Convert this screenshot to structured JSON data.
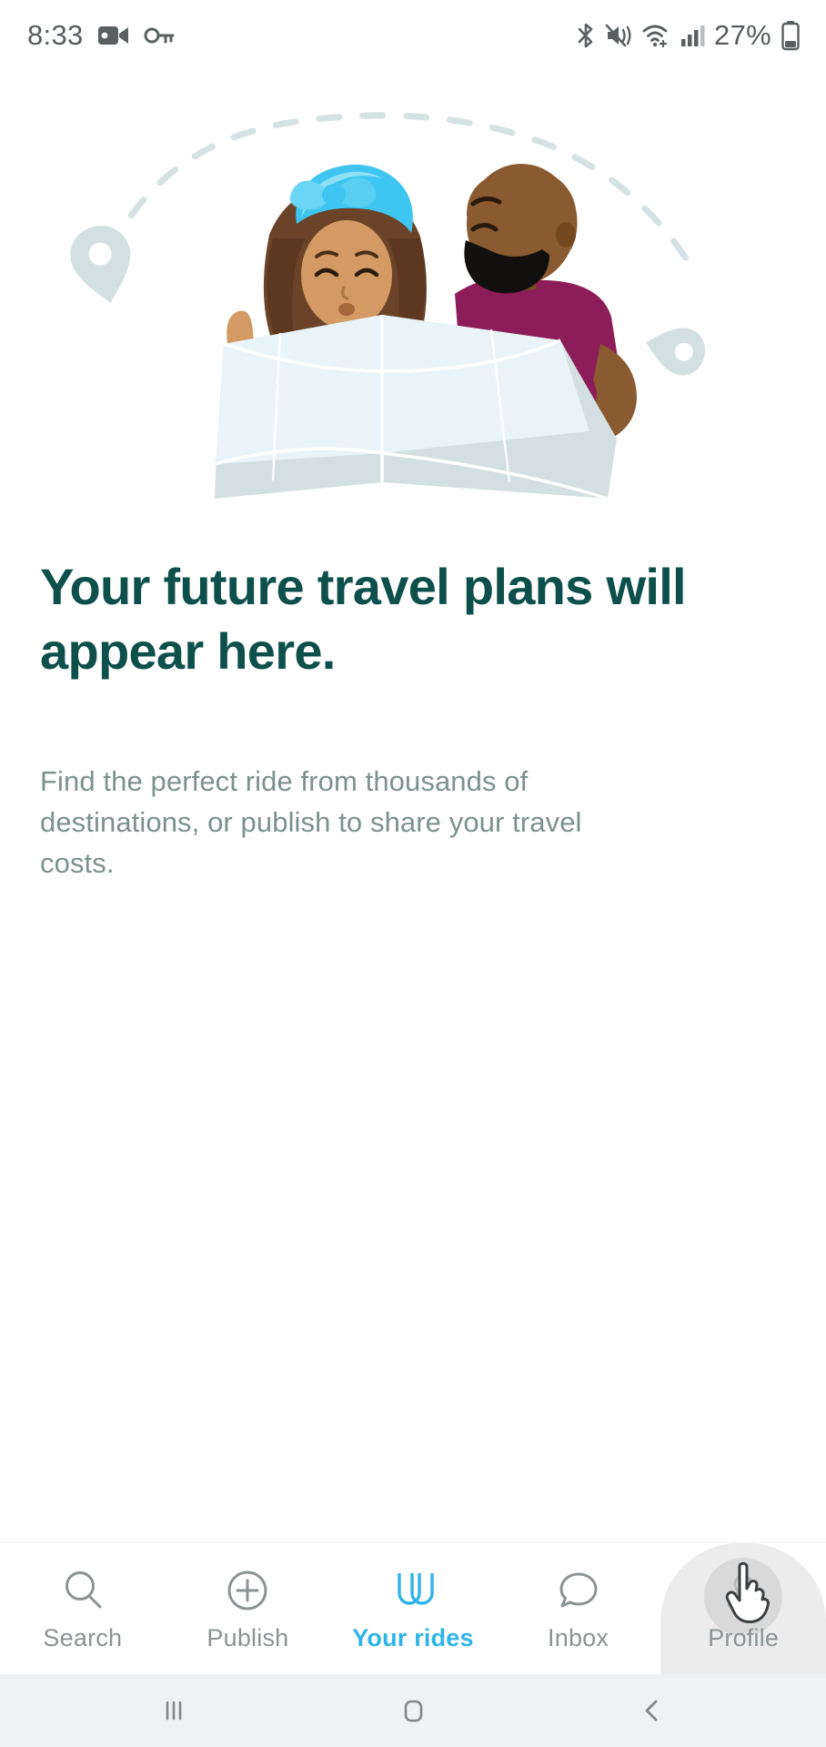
{
  "status_bar": {
    "time": "8:33",
    "battery_percent": "27%",
    "left_icons": [
      "video-camera-icon",
      "vpn-key-icon"
    ],
    "right_icons": [
      "bluetooth-icon",
      "mute-vibrate-icon",
      "wifi-icon",
      "cellular-signal-icon",
      "battery-icon"
    ]
  },
  "illustration": {
    "name": "travel-plans-illustration",
    "alt": "Two people holding a large folded paper map with dashed route arc and map pins",
    "colors": {
      "map_front": "#e9f3f8",
      "map_back": "#d3dfe1",
      "headwrap": "#3fc6f0",
      "hair": "#6b4329",
      "skin_woman": "#d39a64",
      "skin_man": "#8a5a30",
      "shirt_woman": "#7cc442",
      "shirt_man": "#8c1d58",
      "button_teal": "#12a3bf",
      "dash_arc": "#d3e0e2",
      "pin": "#d3e0e2"
    }
  },
  "main": {
    "headline": "Your future travel plans will appear here.",
    "subtext": "Find the perfect ride from thousands of destinations, or publish to share your travel costs."
  },
  "tabbar": {
    "accent_color": "#2fb4e9",
    "inactive_color": "#8d9294",
    "items": [
      {
        "label": "Search",
        "icon": "search-icon",
        "active": false,
        "pressed": false
      },
      {
        "label": "Publish",
        "icon": "plus-circle-icon",
        "active": false,
        "pressed": false
      },
      {
        "label": "Your rides",
        "icon": "blablacar-logo-icon",
        "active": true,
        "pressed": false
      },
      {
        "label": "Inbox",
        "icon": "chat-bubble-icon",
        "active": false,
        "pressed": false
      },
      {
        "label": "Profile",
        "icon": "profile-icon",
        "active": false,
        "pressed": true
      }
    ]
  },
  "android_nav": {
    "recents_label": "Recents",
    "home_label": "Home",
    "back_label": "Back"
  }
}
